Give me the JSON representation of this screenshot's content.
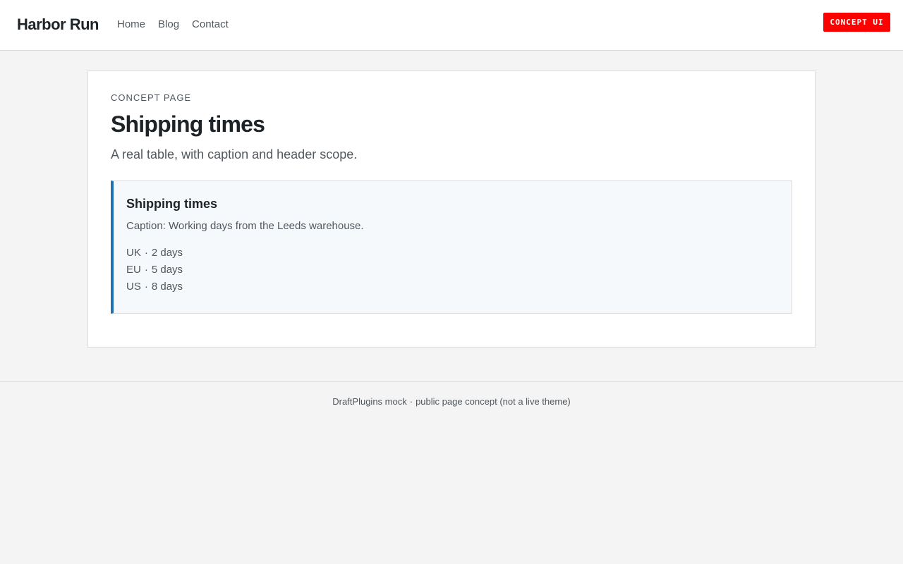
{
  "header": {
    "brand": "Harbor Run",
    "nav": [
      "Home",
      "Blog",
      "Contact"
    ],
    "badge": "CONCEPT UI"
  },
  "main": {
    "eyebrow": "CONCEPT PAGE",
    "title": "Shipping times",
    "subtitle": "A real table, with caption and header scope.",
    "table": {
      "title": "Shipping times",
      "caption": "Caption: Working days from the Leeds warehouse.",
      "separator": "·",
      "rows": [
        {
          "region": "UK",
          "time": "2 days"
        },
        {
          "region": "EU",
          "time": "5 days"
        },
        {
          "region": "US",
          "time": "8 days"
        }
      ]
    }
  },
  "footer": {
    "left": "DraftPlugins mock",
    "separator": "·",
    "right": "public page concept (not a live theme)"
  },
  "colors": {
    "accent": "#2271b1",
    "badge": "#ff0000",
    "background": "#f4f4f4"
  }
}
